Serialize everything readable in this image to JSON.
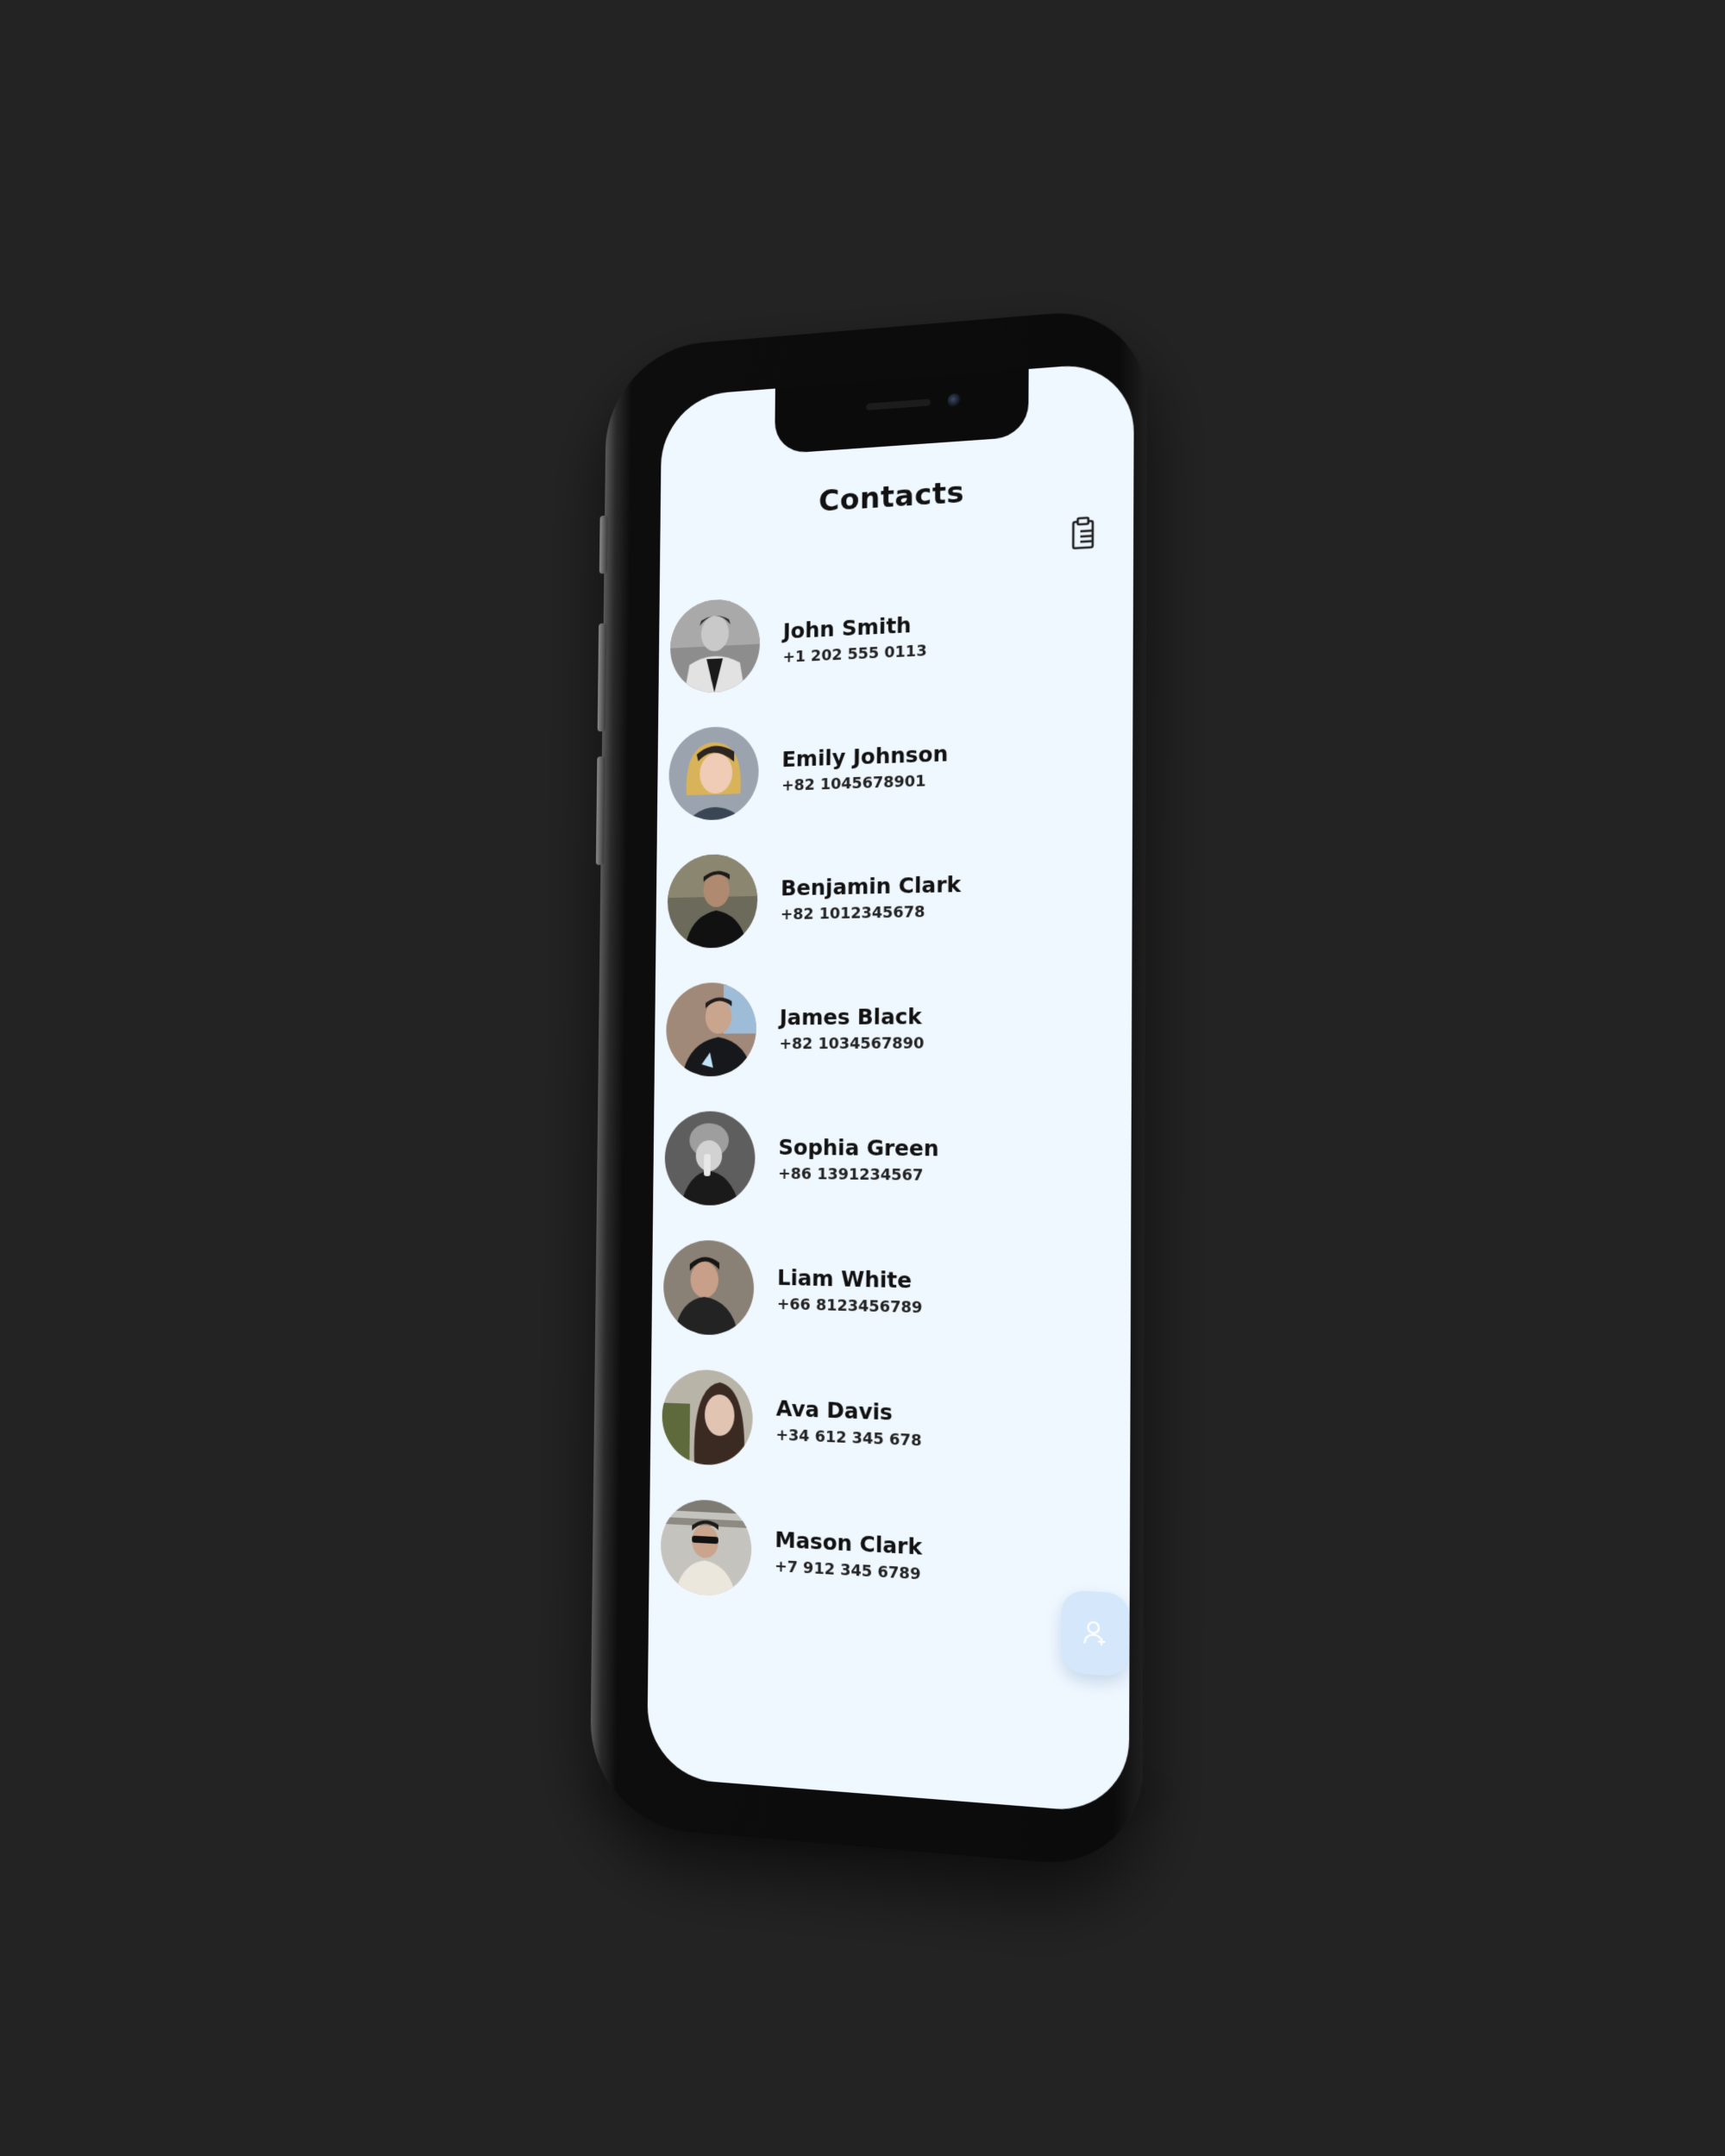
{
  "app": {
    "title": "Contacts"
  },
  "header": {
    "action_icon": "clipboard-delete-icon"
  },
  "contacts": [
    {
      "name": "John Smith",
      "phone": "+1 202 555 0113"
    },
    {
      "name": "Emily Johnson",
      "phone": "+82 1045678901"
    },
    {
      "name": "Benjamin Clark",
      "phone": "+82 1012345678"
    },
    {
      "name": "James Black",
      "phone": "+82 1034567890"
    },
    {
      "name": "Sophia Green",
      "phone": "+86 1391234567"
    },
    {
      "name": "Liam White",
      "phone": "+66 8123456789"
    },
    {
      "name": "Ava Davis",
      "phone": "+34 612 345 678"
    },
    {
      "name": "Mason Clark",
      "phone": "+7 912 345 6789"
    }
  ],
  "fab": {
    "icon": "add-person-icon",
    "color": "#d4e7fb"
  },
  "colors": {
    "background": "#232323",
    "screen": "#f0f8ff",
    "text": "#111111"
  }
}
